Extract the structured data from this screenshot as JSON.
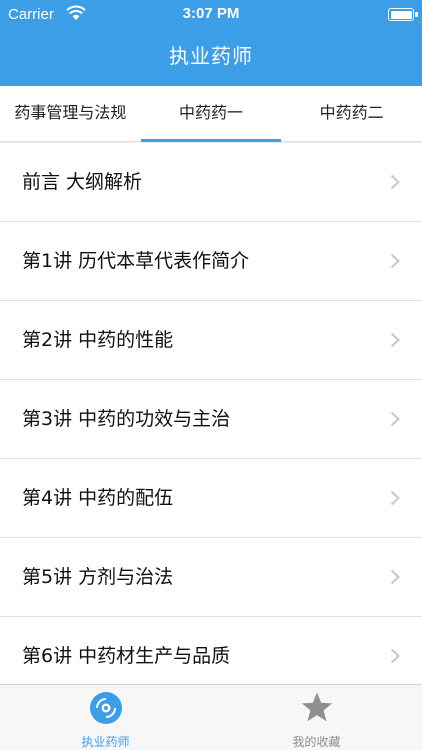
{
  "status_bar": {
    "carrier": "Carrier",
    "time": "3:07 PM",
    "battery_percent": 100
  },
  "nav": {
    "title": "执业药师"
  },
  "tabs": [
    {
      "label": "药事管理与法规",
      "active": false
    },
    {
      "label": "中药药一",
      "active": true
    },
    {
      "label": "中药药二",
      "active": false
    }
  ],
  "chapters": [
    {
      "label": "前言 大纲解析"
    },
    {
      "label": "第1讲 历代本草代表作简介"
    },
    {
      "label": "第2讲 中药的性能"
    },
    {
      "label": "第3讲 中药的功效与主治"
    },
    {
      "label": "第4讲 中药的配伍"
    },
    {
      "label": "第5讲 方剂与治法"
    },
    {
      "label": "第6讲 中药材生产与品质"
    }
  ],
  "tab_bar": {
    "items": [
      {
        "label": "执业药师",
        "icon": "disc-icon",
        "active": true
      },
      {
        "label": "我的收藏",
        "icon": "star-icon",
        "active": false
      }
    ]
  },
  "colors": {
    "accent": "#3b9ee6",
    "inactive": "#8e8e93"
  }
}
